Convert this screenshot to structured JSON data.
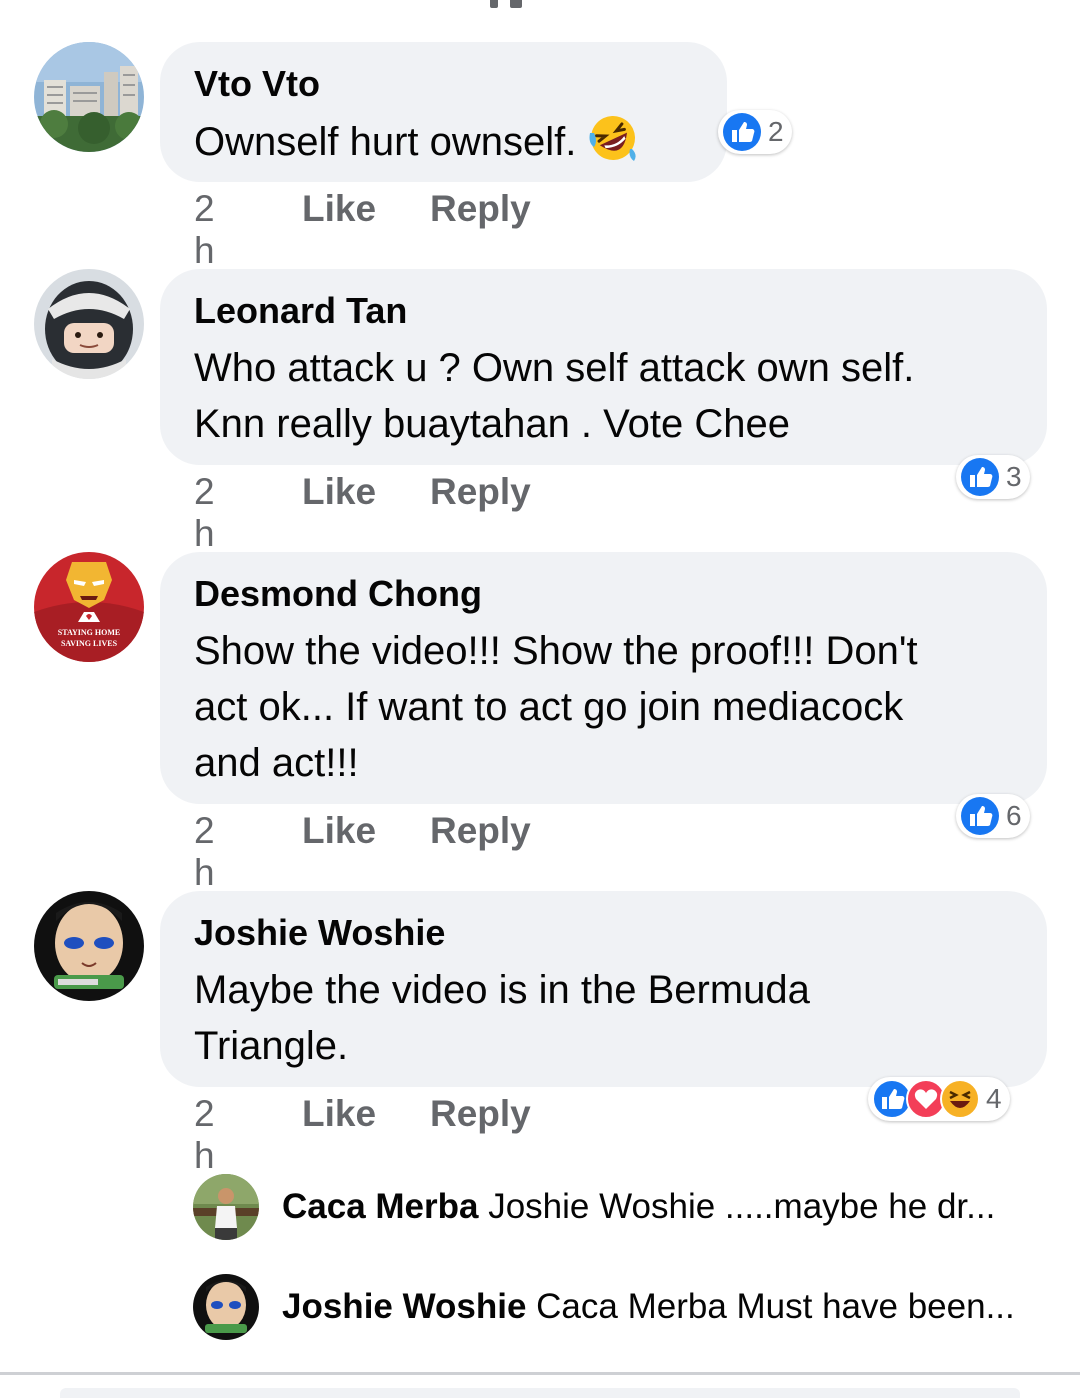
{
  "comments": [
    {
      "author": "Vto Vto",
      "lines": [
        "Ownself hurt ownself."
      ],
      "has_emoji": "rolling-on-floor-laughing",
      "time": "2 h",
      "like_label": "Like",
      "reply_label": "Reply",
      "reaction_count": "2",
      "reactions": [
        "like"
      ]
    },
    {
      "author": "Leonard Tan",
      "lines": [
        "Who attack u ? Own self attack own self.",
        "Knn really buaytahan . Vote Chee"
      ],
      "time": "2 h",
      "like_label": "Like",
      "reply_label": "Reply",
      "reaction_count": "3",
      "reactions": [
        "like"
      ]
    },
    {
      "author": "Desmond Chong",
      "lines": [
        "Show the video!!! Show the proof!!! Don't",
        "act ok... If want to act go join mediacock",
        "and act!!!"
      ],
      "time": "2 h",
      "like_label": "Like",
      "reply_label": "Reply",
      "reaction_count": "6",
      "reactions": [
        "like"
      ],
      "avatar_text": [
        "STAYING HOME",
        "SAVING LIVES"
      ]
    },
    {
      "author": "Joshie Woshie",
      "lines": [
        "Maybe the video is in the Bermuda",
        "Triangle."
      ],
      "time": "2 h",
      "like_label": "Like",
      "reply_label": "Reply",
      "reaction_count": "4",
      "reactions": [
        "like",
        "love",
        "haha"
      ]
    }
  ],
  "replies": [
    {
      "author": "Caca Merba",
      "text": "Joshie Woshie .....maybe he dr..."
    },
    {
      "author": "Joshie Woshie",
      "text": "Caca Merba Must have been..."
    }
  ],
  "colors": {
    "bubble": "#f0f2f5",
    "like_blue": "#1877f2",
    "love_red": "#f33e58",
    "haha_yellow": "#f7b125",
    "meta_gray": "#65676b"
  }
}
